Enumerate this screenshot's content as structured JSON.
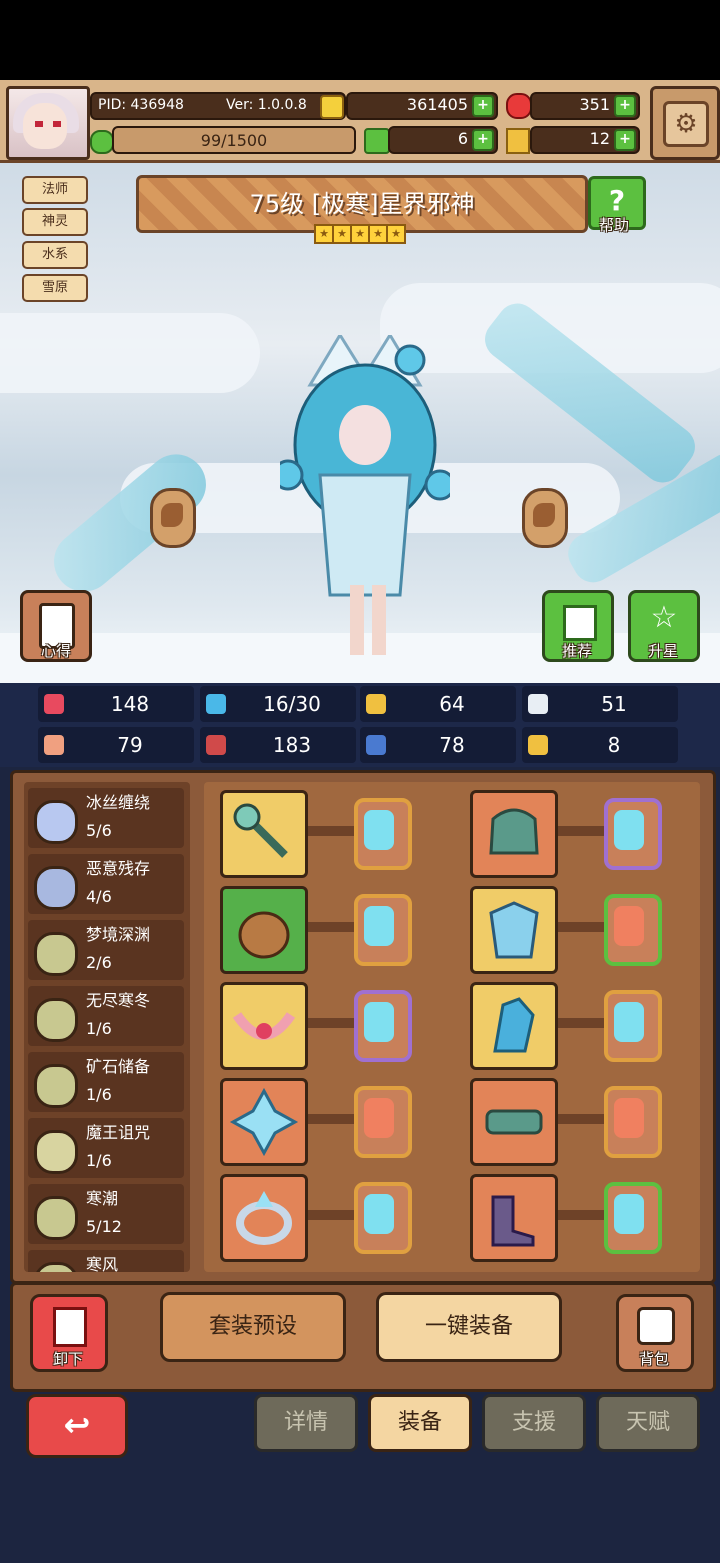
{
  "header": {
    "pid": "PID: 436948",
    "version": "Ver: 1.0.0.8",
    "gold": "361405",
    "gems": "351",
    "energy": "99/1500",
    "clover": "6",
    "keys": "12"
  },
  "tags": [
    "法师",
    "神灵",
    "水系",
    "雪原"
  ],
  "hero": {
    "title": "75级  [极寒]星界邪神",
    "stars": 5
  },
  "buttons": {
    "help": "帮助",
    "notes": "心得",
    "recommend": "推荐",
    "star_up": "升星",
    "unequip": "卸下",
    "set_preset": "套装预设",
    "auto_equip": "一键装备",
    "bag": "背包"
  },
  "stats": [
    {
      "icon": "heart-icon",
      "value": "148",
      "color": "#e84a5f"
    },
    {
      "icon": "water-drop-icon",
      "value": "16/30",
      "color": "#4ab8e8"
    },
    {
      "icon": "shield-icon",
      "value": "64",
      "color": "#f0c040"
    },
    {
      "icon": "wing-icon",
      "value": "51",
      "color": "#e8eef4"
    },
    {
      "icon": "fist-icon",
      "value": "79",
      "color": "#f0a080"
    },
    {
      "icon": "book-icon",
      "value": "183",
      "color": "#d04a4a"
    },
    {
      "icon": "scroll-icon",
      "value": "78",
      "color": "#4a7ad0"
    },
    {
      "icon": "horseshoe-icon",
      "value": "8",
      "color": "#f0c040"
    }
  ],
  "sets": [
    {
      "name": "冰丝缠绕",
      "count": "5/6",
      "color": "#b8c8f0"
    },
    {
      "name": "恶意残存",
      "count": "4/6",
      "color": "#a8b8e0"
    },
    {
      "name": "梦境深渊",
      "count": "2/6",
      "color": "#c8c890"
    },
    {
      "name": "无尽寒冬",
      "count": "1/6",
      "color": "#c8c890"
    },
    {
      "name": "矿石储备",
      "count": "1/6",
      "color": "#c8c890"
    },
    {
      "name": "魔王诅咒",
      "count": "1/6",
      "color": "#d8d4a0"
    },
    {
      "name": "寒潮",
      "count": "5/12",
      "color": "#c8c890"
    },
    {
      "name": "寒风",
      "count": "",
      "color": "#c8c890"
    }
  ],
  "tabs": [
    "详情",
    "装备",
    "支援",
    "天赋"
  ],
  "active_tab": "装备"
}
